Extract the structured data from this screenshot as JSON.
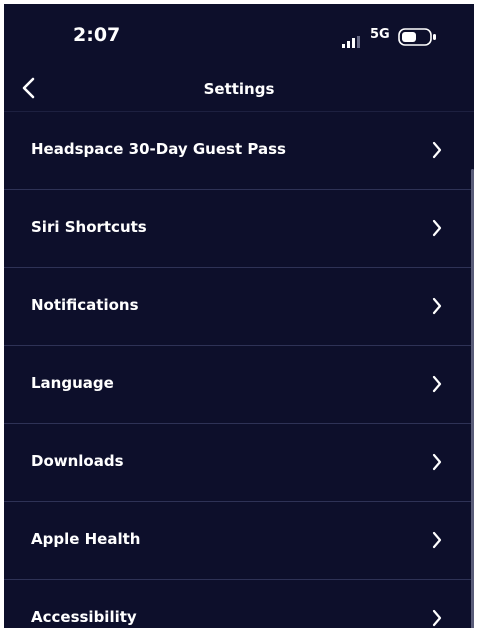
{
  "status_bar": {
    "time": "2:07",
    "network": "5G",
    "signal_icon": "cellular-signal-icon",
    "battery_icon": "battery-icon"
  },
  "nav": {
    "title": "Settings",
    "back_icon": "chevron-left-icon"
  },
  "settings_items": [
    {
      "label": "Headspace 30-Day Guest Pass"
    },
    {
      "label": "Siri Shortcuts"
    },
    {
      "label": "Notifications"
    },
    {
      "label": "Language"
    },
    {
      "label": "Downloads"
    },
    {
      "label": "Apple Health"
    },
    {
      "label": "Accessibility"
    }
  ],
  "colors": {
    "background": "#0d0f2b",
    "divider": "#2e3256",
    "text": "#ffffff"
  }
}
